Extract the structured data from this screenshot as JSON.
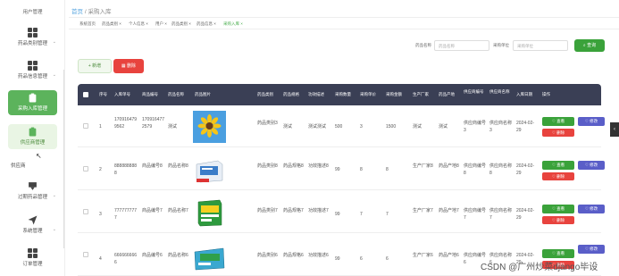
{
  "sidebar": {
    "top_label": "用户管理",
    "items": [
      {
        "label": "药品类别管理",
        "icon": "grid-icon"
      },
      {
        "label": "药品信息管理",
        "icon": "grid-icon"
      },
      {
        "label": "采购入库管理",
        "icon": "clipboard-icon"
      },
      {
        "label": "供应商管理",
        "icon": "clipboard-icon"
      },
      {
        "label": "过期药品管理",
        "icon": "bookmark-icon"
      },
      {
        "label": "系统管理",
        "icon": "send-icon"
      },
      {
        "label": "订单管理",
        "icon": "grid-icon"
      }
    ],
    "submenu_label": "供应商"
  },
  "breadcrumb": {
    "home": "首页",
    "sep": "/",
    "current": "采购入库"
  },
  "tags": [
    "系统首页",
    "药品类别 ×",
    "个人信息 ×",
    "用户 ×",
    "药品类别 ×",
    "药品信息 ×",
    "采购入库 ×"
  ],
  "search": {
    "field1_label": "药品名称",
    "field1_placeholder": "药品名称",
    "field2_label": "采购单位",
    "field2_placeholder": "采购单位",
    "button": "查询"
  },
  "toolbar": {
    "add": "+ 新增",
    "delete": "删除"
  },
  "table": {
    "headers": [
      "序号",
      "入库单号",
      "商品编号",
      "药品名称",
      "药品图片",
      "药品类别",
      "药品规格",
      "功效描述",
      "采购数量",
      "采购单价",
      "采购金额",
      "生产厂家",
      "药品产地",
      "供应商编号",
      "供应商名称",
      "入库日期",
      "操作"
    ],
    "rows": [
      {
        "index": "1",
        "order_no": "1709164799562",
        "goods_no": "1709164772579",
        "name": "测试",
        "image": "sunflower",
        "category": "药品类别3",
        "spec": "测试",
        "effect": "测试测试",
        "qty": "500",
        "price": "3",
        "amount": "1500",
        "maker": "测试",
        "origin": "测试",
        "supplier_no": "供应商编号3",
        "supplier_name": "供应商名称3",
        "date": "2024-02-29"
      },
      {
        "index": "2",
        "order_no": "8888888888",
        "goods_no": "商品编号8",
        "name": "药品名称8",
        "image": "medicine-box-blue",
        "category": "药品类别8",
        "spec": "药品规格8",
        "effect": "功效描述8",
        "qty": "99",
        "price": "8",
        "amount": "8",
        "maker": "生产厂家8",
        "origin": "药品产地8",
        "supplier_no": "供应商编号8",
        "supplier_name": "供应商名称8",
        "date": "2024-02-29"
      },
      {
        "index": "3",
        "order_no": "7777777777",
        "goods_no": "商品编号7",
        "name": "药品名称7",
        "image": "medicine-box-green",
        "category": "药品类别7",
        "spec": "药品规格7",
        "effect": "功效描述7",
        "qty": "99",
        "price": "7",
        "amount": "7",
        "maker": "生产厂家7",
        "origin": "药品产地7",
        "supplier_no": "供应商编号7",
        "supplier_name": "供应商名称7",
        "date": "2024-02-29"
      },
      {
        "index": "4",
        "order_no": "6666666666",
        "goods_no": "商品编号6",
        "name": "药品名称6",
        "image": "medicine-box-green2",
        "category": "药品类别6",
        "spec": "药品规格6",
        "effect": "功效描述6",
        "qty": "99",
        "price": "6",
        "amount": "6",
        "maker": "生产厂家6",
        "origin": "药品产地6",
        "supplier_no": "供应商编号6",
        "supplier_name": "供应商名称6",
        "date": "2024-02-29"
      }
    ],
    "actions": {
      "view": "♡ 查看",
      "edit": "♡ 修改",
      "delete": "♡ 删除"
    }
  },
  "watermark": "CSDN @广州炒菜django毕设",
  "colors": {
    "primary": "#3aa23a",
    "danger": "#e8433e",
    "edit": "#5a5ec8",
    "header": "#3a3f55"
  }
}
